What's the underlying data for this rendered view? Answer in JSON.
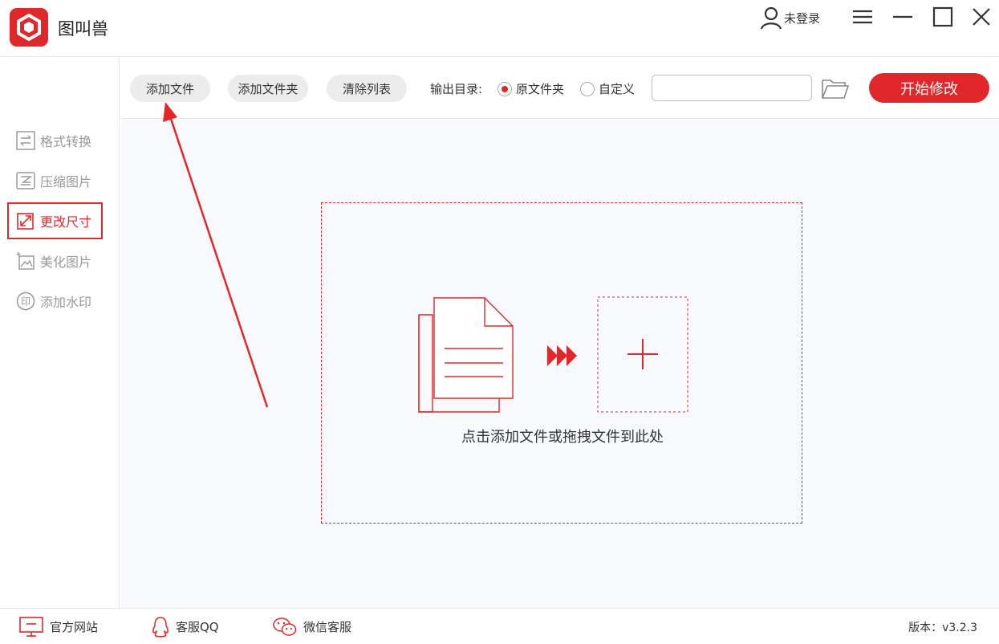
{
  "app": {
    "title": "图叫兽"
  },
  "user": {
    "label": "未登录"
  },
  "sidebar": {
    "items": [
      {
        "label": "格式转换",
        "icon": "format-convert-icon"
      },
      {
        "label": "压缩图片",
        "icon": "compress-icon"
      },
      {
        "label": "更改尺寸",
        "icon": "resize-icon",
        "active": true
      },
      {
        "label": "美化图片",
        "icon": "beautify-icon"
      },
      {
        "label": "添加水印",
        "icon": "watermark-icon"
      }
    ]
  },
  "toolbar": {
    "add_file": "添加文件",
    "add_folder": "添加文件夹",
    "clear_list": "清除列表",
    "output_label": "输出目录:",
    "radio_original": "原文件夹",
    "radio_custom": "自定义",
    "output_path": "",
    "start": "开始修改"
  },
  "main": {
    "drop_hint": "点击添加文件或拖拽文件到此处"
  },
  "footer": {
    "website": "官方网站",
    "qq": "客服QQ",
    "wechat": "微信客服",
    "version": "版本：v3.2.3"
  },
  "colors": {
    "accent": "#e0282a",
    "background": "#f7f9fc"
  }
}
